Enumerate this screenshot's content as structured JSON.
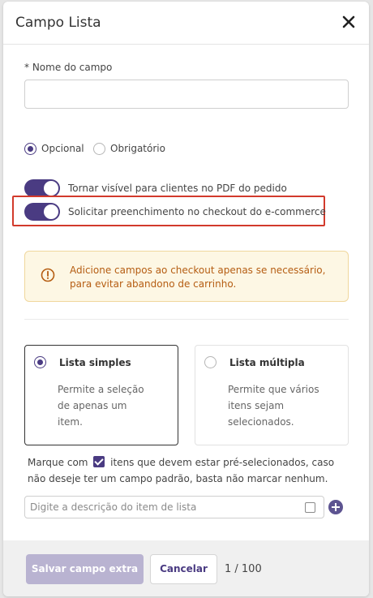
{
  "dialog": {
    "title": "Campo Lista"
  },
  "field": {
    "label": "* Nome do campo",
    "value": ""
  },
  "requirement": {
    "optional_label": "Opcional",
    "required_label": "Obrigatório",
    "selected": "Opcional"
  },
  "toggles": [
    {
      "label": "Tornar visível para clientes no PDF do pedido",
      "on": true
    },
    {
      "label": "Solicitar preenchimento no checkout do e-commerce",
      "on": true
    }
  ],
  "alert": {
    "icon": "warning-circle-icon",
    "text": "Adicione campos ao checkout apenas se necessário, para evitar abandono de carrinho."
  },
  "list_type": {
    "options": [
      {
        "title": "Lista simples",
        "description": "Permite a seleção de apenas um item.",
        "selected": true
      },
      {
        "title": "Lista múltipla",
        "description": "Permite que vários itens sejam selecionados.",
        "selected": false
      }
    ]
  },
  "note": {
    "before": "Marque com",
    "after": "itens que devem estar pré-selecionados, caso não deseje ter um campo padrão, basta não marcar nenhum."
  },
  "item_input": {
    "placeholder": "Digite a descrição do item de lista",
    "value": ""
  },
  "footer": {
    "save_label": "Salvar campo extra",
    "cancel_label": "Cancelar",
    "counter": "1 / 100"
  },
  "colors": {
    "accent": "#4a3b82",
    "highlight": "#d23a2c",
    "alert_text": "#b55d12",
    "alert_bg": "#fdf7e4"
  }
}
